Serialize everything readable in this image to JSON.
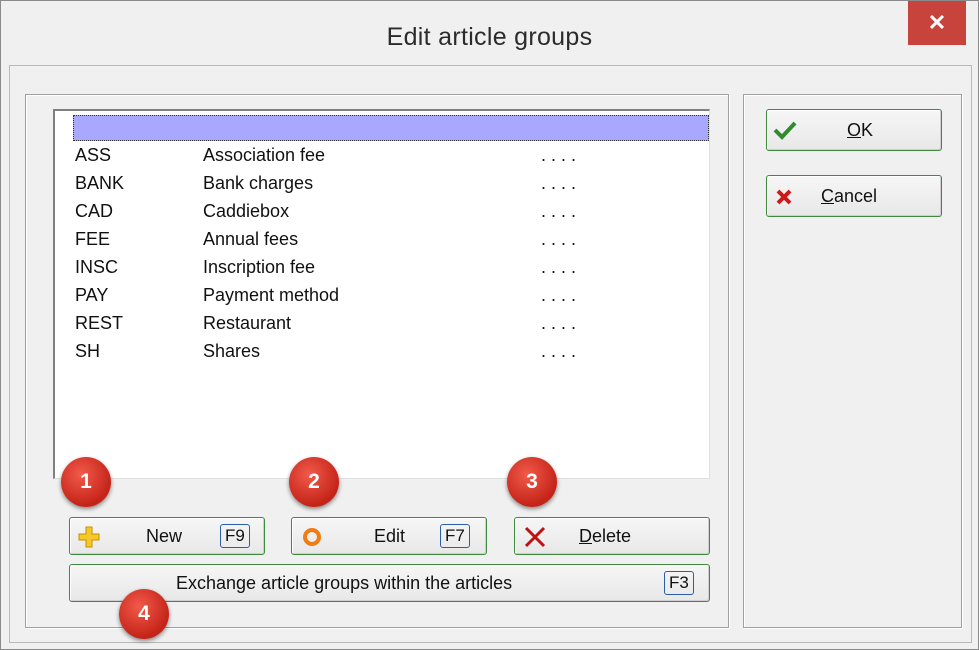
{
  "window": {
    "title": "Edit article groups",
    "close_glyph": "✕"
  },
  "list": {
    "rows": [
      {
        "code": "ASS",
        "description": "Association fee",
        "dots": ". . . ."
      },
      {
        "code": "BANK",
        "description": "Bank charges",
        "dots": ". . . ."
      },
      {
        "code": "CAD",
        "description": "Caddiebox",
        "dots": ". . . ."
      },
      {
        "code": "FEE",
        "description": "Annual fees",
        "dots": ". . . ."
      },
      {
        "code": "INSC",
        "description": "Inscription fee",
        "dots": ". . . ."
      },
      {
        "code": "PAY",
        "description": "Payment method",
        "dots": ". . . ."
      },
      {
        "code": "REST",
        "description": "Restaurant",
        "dots": ". . . ."
      },
      {
        "code": "SH",
        "description": "Shares",
        "dots": ". . . ."
      }
    ]
  },
  "buttons": {
    "new": {
      "label": "New",
      "key": "F9"
    },
    "edit": {
      "label": "Edit",
      "key": "F7"
    },
    "delete": {
      "label_underlined": "D",
      "label_rest": "elete"
    },
    "exchange": {
      "label": "Exchange article groups within the articles",
      "key": "F3"
    },
    "ok": {
      "label_underlined": "O",
      "label_rest": "K"
    },
    "cancel": {
      "label_underlined": "C",
      "label_rest": "ancel"
    }
  },
  "badges": {
    "one": "1",
    "two": "2",
    "three": "3",
    "four": "4"
  },
  "icons": {
    "new": "plus-icon",
    "edit": "circle-icon",
    "delete": "x-icon",
    "ok": "checkmark-icon",
    "cancel": "red-x-icon"
  },
  "colors": {
    "close_button": "#c7433c",
    "button_border": "#3f8a3f",
    "list_header": "#a8a8ff",
    "badge": "#d9322a"
  }
}
